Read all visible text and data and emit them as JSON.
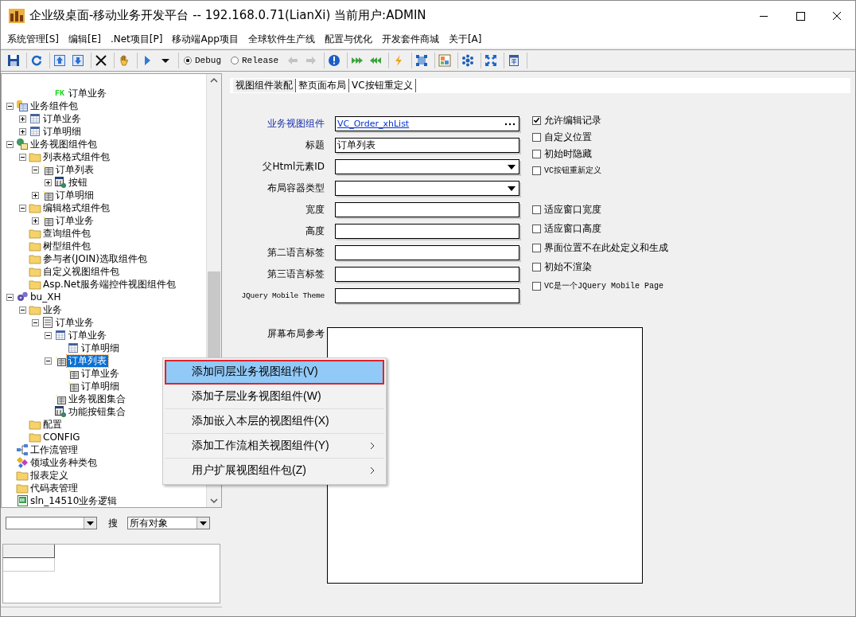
{
  "window": {
    "title": "企业级桌面-移动业务开发平台 -- 192.168.0.71(LianXi) 当前用户:ADMIN"
  },
  "menu": [
    "系统管理[S]",
    "编辑[E]",
    ".Net项目[P]",
    "移动端App项目",
    "全球软件生产线",
    "配置与优化",
    "开发套件商城",
    "关于[A]"
  ],
  "toolbar": {
    "groups": [
      [
        {
          "kind": "save",
          "disabled": false
        }
      ],
      [
        {
          "kind": "refresh",
          "disabled": false
        }
      ],
      [
        {
          "kind": "up",
          "disabled": false
        },
        {
          "kind": "down",
          "disabled": false
        }
      ],
      [
        {
          "kind": "delete",
          "disabled": false
        }
      ],
      [
        {
          "kind": "hand",
          "disabled": false
        }
      ],
      [
        {
          "kind": "play",
          "disabled": false
        },
        {
          "kind": "caret",
          "disabled": false
        }
      ]
    ],
    "build_modes": [
      {
        "label": "Debug",
        "selected": true
      },
      {
        "label": "Release",
        "selected": false
      }
    ],
    "groups2": [
      [
        {
          "kind": "back",
          "disabled": true
        },
        {
          "kind": "forward",
          "disabled": true
        }
      ],
      [
        {
          "kind": "info",
          "disabled": false
        }
      ],
      [
        {
          "kind": "push",
          "disabled": false
        },
        {
          "kind": "pull",
          "disabled": false
        }
      ],
      [
        {
          "kind": "bolt",
          "disabled": false
        }
      ],
      [
        {
          "kind": "select",
          "disabled": false
        }
      ],
      [
        {
          "kind": "image",
          "disabled": false
        }
      ],
      [
        {
          "kind": "snow",
          "disabled": false
        }
      ],
      [
        {
          "kind": "expand",
          "disabled": false
        }
      ],
      [
        {
          "kind": "grid",
          "disabled": false
        }
      ]
    ]
  },
  "tree": {
    "clipped_rows": [
      {
        "badge": "FK",
        "label": "订单业务",
        "selected": false
      }
    ],
    "items": [
      {
        "label": "业务组件包",
        "kind": "package-db",
        "expanded": true,
        "selected": false,
        "children": [
          {
            "label": "订单业务",
            "kind": "table",
            "expanded": false,
            "selected": false
          },
          {
            "label": "订单明细",
            "kind": "table",
            "expanded": false,
            "selected": false
          }
        ]
      },
      {
        "label": "业务视图组件包",
        "kind": "package-globe",
        "expanded": true,
        "selected": false,
        "children": [
          {
            "label": "列表格式组件包",
            "kind": "folder",
            "expanded": true,
            "selected": false,
            "children": [
              {
                "label": "订单列表",
                "kind": "view",
                "expanded": true,
                "selected": false,
                "children": [
                  {
                    "label": "按钮",
                    "kind": "buttons",
                    "expanded": false,
                    "selected": false
                  }
                ]
              },
              {
                "label": "订单明细",
                "kind": "view",
                "expanded": false,
                "selected": false
              }
            ]
          },
          {
            "label": "编辑格式组件包",
            "kind": "folder",
            "expanded": true,
            "selected": false,
            "children": [
              {
                "label": "订单业务",
                "kind": "view",
                "expanded": false,
                "selected": false
              }
            ]
          },
          {
            "label": "查询组件包",
            "kind": "folder",
            "selected": false
          },
          {
            "label": "树型组件包",
            "kind": "folder",
            "selected": false
          },
          {
            "label": "参与者(JOIN)选取组件包",
            "kind": "folder",
            "selected": false
          },
          {
            "label": "自定义视图组件包",
            "kind": "folder",
            "selected": false
          },
          {
            "label": "Asp.Net服务端控件视图组件包",
            "kind": "folder",
            "selected": false
          }
        ]
      },
      {
        "label": "bu_XH",
        "kind": "gears",
        "expanded": true,
        "selected": false,
        "children": [
          {
            "label": "业务",
            "kind": "folder",
            "expanded": true,
            "selected": false,
            "children": [
              {
                "label": "订单业务",
                "kind": "form",
                "expanded": true,
                "selected": false,
                "children": [
                  {
                    "label": "订单业务",
                    "kind": "table",
                    "expanded": true,
                    "selected": false,
                    "children": [
                      {
                        "label": "订单明细",
                        "kind": "table",
                        "selected": false
                      }
                    ]
                  },
                  {
                    "label": "订单列表",
                    "kind": "view",
                    "expanded": true,
                    "selected": true,
                    "children": [
                      {
                        "label": "订单业务",
                        "kind": "view",
                        "selected": false
                      },
                      {
                        "label": "订单明细",
                        "kind": "view",
                        "selected": false
                      }
                    ]
                  },
                  {
                    "label": "业务视图集合",
                    "kind": "view",
                    "selected": false
                  },
                  {
                    "label": "功能按钮集合",
                    "kind": "buttons",
                    "selected": false
                  }
                ]
              }
            ]
          },
          {
            "label": "配置",
            "kind": "folder",
            "selected": false
          },
          {
            "label": "CONFIG",
            "kind": "folder",
            "selected": false
          }
        ]
      },
      {
        "label": "工作流管理",
        "kind": "workflow",
        "selected": false
      },
      {
        "label": "领域业务种类包",
        "kind": "domain",
        "selected": false
      },
      {
        "label": "报表定义",
        "kind": "folder",
        "selected": false
      },
      {
        "label": "代码表管理",
        "kind": "folder",
        "selected": false
      },
      {
        "label": "sln_14510业务逻辑",
        "kind": "csharp",
        "selected": false
      }
    ]
  },
  "search": {
    "search_label": "搜",
    "scope": "所有对象"
  },
  "tabs": [
    {
      "label": "视图组件装配",
      "selected": true
    },
    {
      "label": "整页面布局",
      "selected": false
    },
    {
      "label": "VC按钮重定义",
      "selected": false
    }
  ],
  "fields": [
    {
      "label": "业务视图组件",
      "kind": "link",
      "value": "VC_Order_xhList"
    },
    {
      "label": "标题",
      "kind": "text",
      "value": "订单列表"
    },
    {
      "label": "父Html元素ID",
      "kind": "dropdown"
    },
    {
      "label": "布局容器类型",
      "kind": "dropdown"
    },
    {
      "label": "宽度",
      "kind": "text"
    },
    {
      "label": "高度",
      "kind": "text"
    },
    {
      "label": "第二语言标签",
      "kind": "text"
    },
    {
      "label": "第三语言标签",
      "kind": "text"
    },
    {
      "label": "JQuery Mobile Theme",
      "kind": "text"
    }
  ],
  "options_top": [
    {
      "label": "允许编辑记录",
      "checked": true
    },
    {
      "label": "自定义位置",
      "checked": false
    },
    {
      "label": "初始时隐藏",
      "checked": false
    },
    {
      "label": "VC按钮重新定义",
      "checked": false
    }
  ],
  "options_bottom": [
    {
      "label": "适应窗口宽度",
      "checked": false
    },
    {
      "label": "适应窗口高度",
      "checked": false
    },
    {
      "label": "界面位置不在此处定义和生成",
      "checked": false
    },
    {
      "label": "初始不渲染",
      "checked": false
    },
    {
      "label": "VC是一个JQuery Mobile Page",
      "checked": false
    }
  ],
  "layout_preview": {
    "label": "屏幕布局参考"
  },
  "context_menu": [
    {
      "label": "添加同层业务视图组件(V)",
      "selected": true,
      "submenu": false
    },
    {
      "label": "添加子层业务视图组件(W)",
      "selected": false,
      "submenu": false
    },
    {
      "label": "添加嵌入本层的视图组件(X)",
      "selected": false,
      "submenu": false
    },
    {
      "label": "添加工作流相关视图组件(Y)",
      "selected": false,
      "submenu": true
    },
    {
      "label": "用户扩展视图组件包(Z)",
      "selected": false,
      "submenu": true
    }
  ]
}
